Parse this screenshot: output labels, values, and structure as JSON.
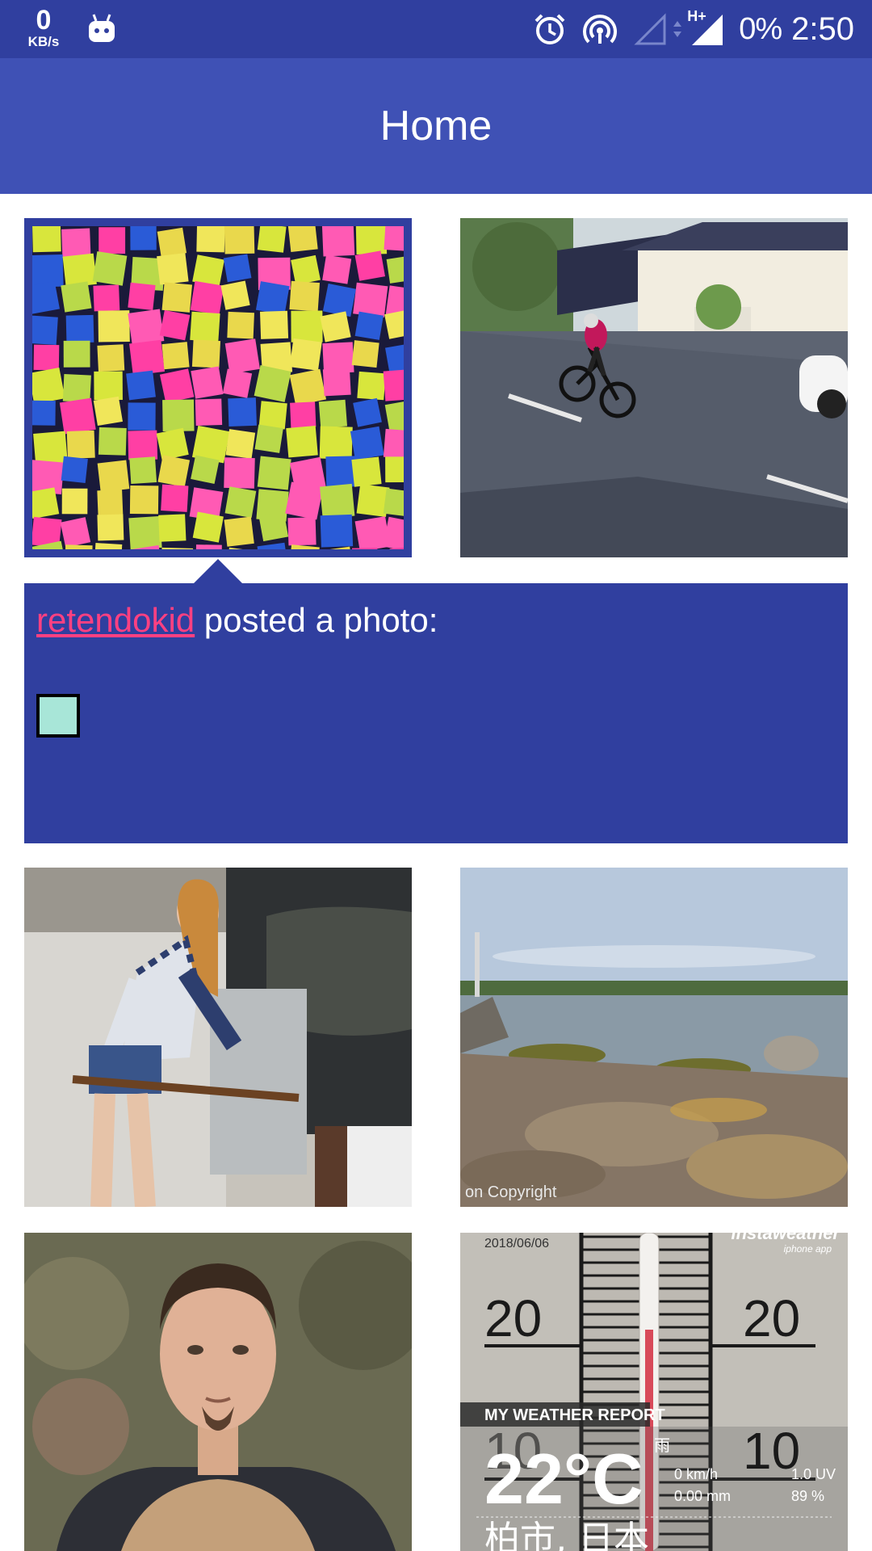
{
  "status_bar": {
    "net_speed_value": "0",
    "net_speed_unit": "KB/s",
    "network_type": "H+",
    "battery": "0%",
    "time": "2:50",
    "icons": [
      "android-icon",
      "alarm-icon",
      "hotspot-icon",
      "signal-empty-icon",
      "data-arrows-icon",
      "signal-full-icon"
    ]
  },
  "app_bar": {
    "title": "Home"
  },
  "feed": {
    "selected_index": 0,
    "items": [
      {
        "label": "sticky-notes-photo"
      },
      {
        "label": "cyclist-photo"
      },
      {
        "label": "woman-cave-photo"
      },
      {
        "label": "coastline-photo",
        "watermark": "on Copyright"
      },
      {
        "label": "portrait-photo"
      },
      {
        "label": "thermometer-photo",
        "date": "2018/06/06",
        "brand": "instaweather",
        "brand_sub": "iphone app",
        "scale_labels": [
          "20",
          "20",
          "10",
          "10"
        ],
        "report_title": "MY WEATHER REPORT",
        "temperature": "22°C",
        "condition": "雨",
        "wind": "0 km/h",
        "uv": "1.0 UV",
        "rain": "0.00 mm",
        "humidity": "89 %",
        "location": "柏市, 日本"
      }
    ]
  },
  "detail": {
    "username": "retendokid",
    "action_text": " posted a photo:",
    "thumbnail_color": "#a8e6d8"
  },
  "colors": {
    "status_bar": "#303f9f",
    "app_bar": "#3f51b5",
    "accent": "#ff4081"
  }
}
